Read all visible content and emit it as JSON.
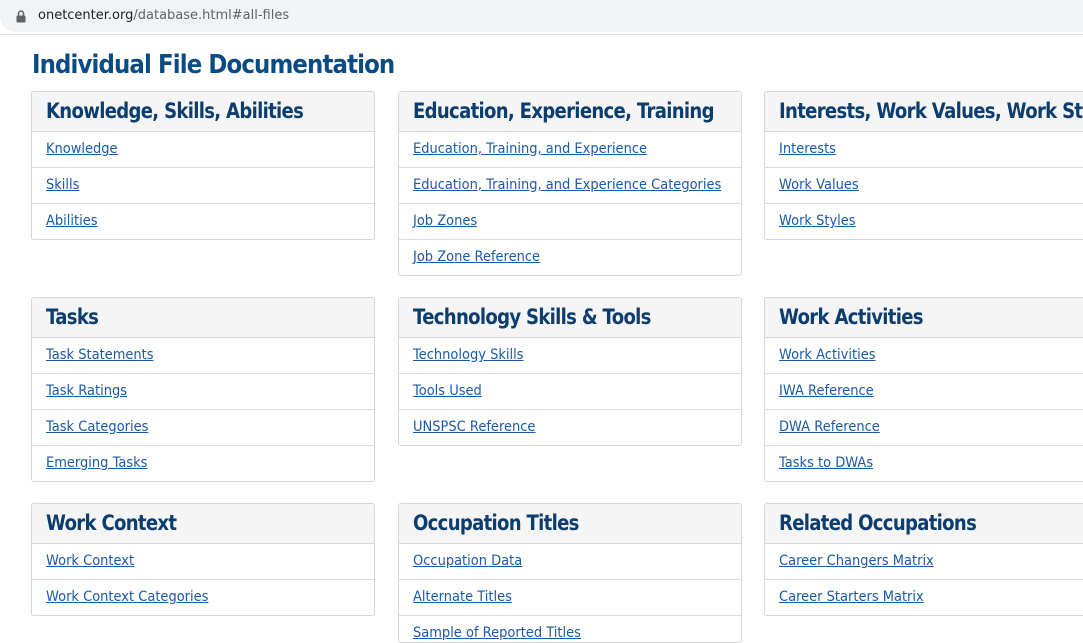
{
  "browser": {
    "url_domain": "onetcenter.org",
    "url_path": "/database.html#all-files"
  },
  "page": {
    "title": "Individual File Documentation"
  },
  "cards": [
    {
      "title": "Knowledge, Skills, Abilities",
      "links": [
        "Knowledge",
        "Skills",
        "Abilities"
      ]
    },
    {
      "title": "Education, Experience, Training",
      "links": [
        "Education, Training, and Experience",
        "Education, Training, and Experience Categories",
        "Job Zones",
        "Job Zone Reference"
      ]
    },
    {
      "title": "Interests, Work Values, Work Styles",
      "links": [
        "Interests",
        "Work Values",
        "Work Styles"
      ]
    },
    {
      "title": "Tasks",
      "links": [
        "Task Statements",
        "Task Ratings",
        "Task Categories",
        "Emerging Tasks"
      ]
    },
    {
      "title": "Technology Skills & Tools",
      "links": [
        "Technology Skills",
        "Tools Used",
        "UNSPSC Reference"
      ]
    },
    {
      "title": "Work Activities",
      "links": [
        "Work Activities",
        "IWA Reference",
        "DWA Reference",
        "Tasks to DWAs"
      ]
    },
    {
      "title": "Work Context",
      "links": [
        "Work Context",
        "Work Context Categories"
      ]
    },
    {
      "title": "Occupation Titles",
      "links": [
        "Occupation Data",
        "Alternate Titles",
        "Sample of Reported Titles"
      ]
    },
    {
      "title": "Related Occupations",
      "links": [
        "Career Changers Matrix",
        "Career Starters Matrix"
      ]
    }
  ]
}
